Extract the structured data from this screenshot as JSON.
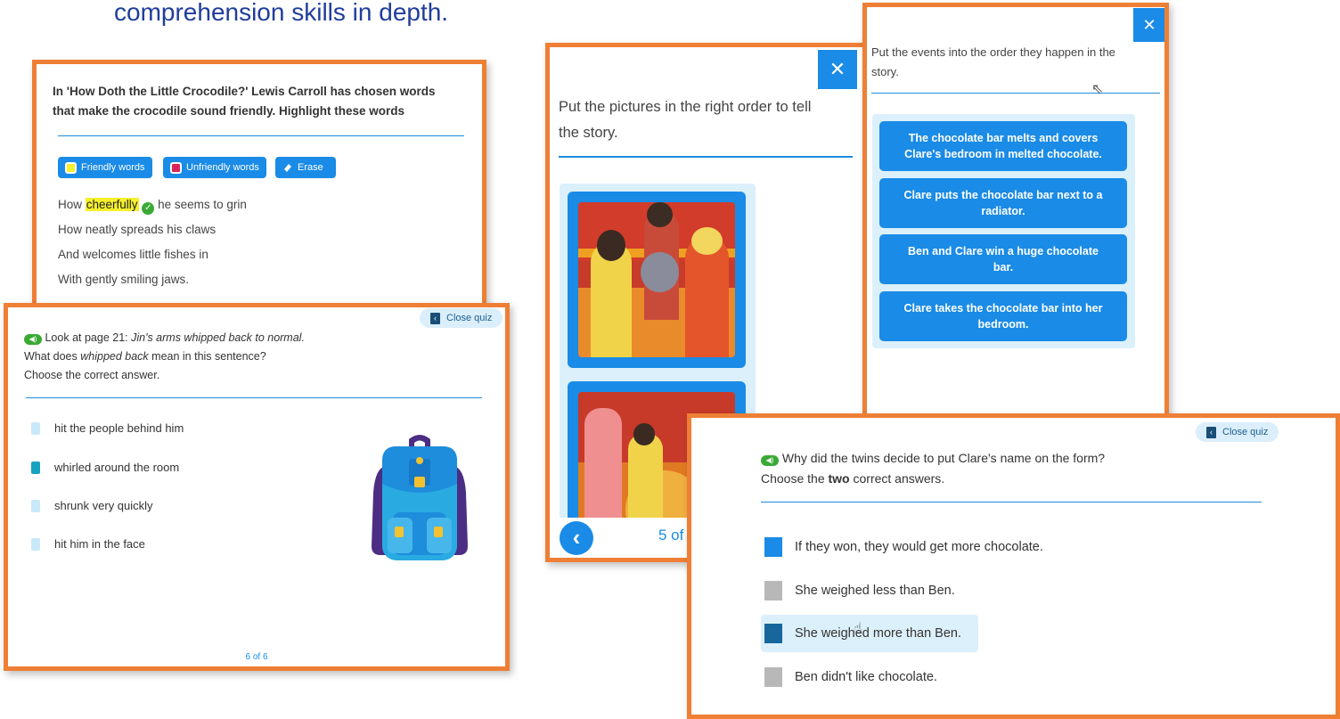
{
  "heading": "comprehension skills in depth.",
  "panel_highlight": {
    "question": "In 'How Doth the Little Crocodile?' Lewis Carroll has chosen words that make the crocodile sound friendly. Highlight these words",
    "tools": [
      {
        "label": "Friendly words",
        "swatch": "#f5f02c"
      },
      {
        "label": "Unfriendly words",
        "swatch": "#d8245b"
      },
      {
        "label": "Erase"
      }
    ],
    "lines": [
      {
        "before": "How ",
        "highlight": "cheerfully",
        "after": " he seems to grin"
      },
      {
        "text": "How neatly spreads his claws"
      },
      {
        "text": "And welcomes little fishes in"
      },
      {
        "text": "With gently smiling jaws."
      }
    ]
  },
  "panel_quiz": {
    "close_label": "Close quiz",
    "prompt_lead": "Look at page 21: ",
    "prompt_quote": "Jin's arms whipped back to normal.",
    "line2_a": "What does ",
    "line2_em": "whipped back",
    "line2_b": " mean in this sentence?",
    "line3": "Choose the correct answer.",
    "options": [
      {
        "label": "hit the people behind him",
        "selected": false
      },
      {
        "label": "whirled around the room",
        "selected": true
      },
      {
        "label": "shrunk very quickly",
        "selected": false
      },
      {
        "label": "hit him in the face",
        "selected": false
      }
    ],
    "pager": "6 of 6"
  },
  "panel_pictures": {
    "close_symbol": "✕",
    "question": "Put the pictures in the right order to tell the story.",
    "back_symbol": "‹",
    "count": "5 of"
  },
  "panel_events": {
    "close_symbol": "✕",
    "question": "Put the events into the order they happen in the story.",
    "events": [
      "The chocolate bar melts and covers Clare's bedroom in melted chocolate.",
      "Clare puts the chocolate bar next to a radiator.",
      "Ben and Clare win a huge chocolate bar.",
      "Clare takes the chocolate bar into her bedroom."
    ]
  },
  "panel_twins": {
    "close_label": "Close quiz",
    "q_line1": "Why did the twins decide to put Clare's name on the form?",
    "q_line2_a": "Choose the ",
    "q_line2_b": "two",
    "q_line2_c": " correct answers.",
    "answers": [
      {
        "label": "If they won, they would get more chocolate.",
        "color": "#1a8be6"
      },
      {
        "label": "She weighed less than Ben.",
        "color": "#b8b8b8"
      },
      {
        "label": "She weighed more than Ben.",
        "color": "#17679c"
      },
      {
        "label": "Ben didn't like chocolate.",
        "color": "#b8b8b8"
      }
    ]
  },
  "colors": {
    "accent": "#1a8be6",
    "frame": "#ee7f35",
    "heading": "#1f3d9c"
  }
}
